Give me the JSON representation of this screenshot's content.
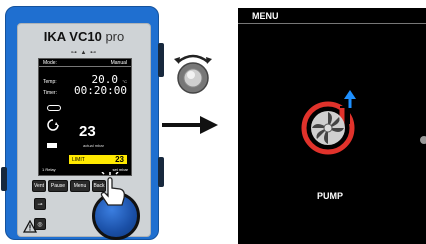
{
  "device": {
    "brand": "IKA VC10",
    "model_suffix": "pro",
    "display": {
      "mode_label": "Mode:",
      "mode_value": "Manual",
      "temp_label": "Temp:",
      "temp_value": "20.0",
      "temp_unit": "°C",
      "timer_label": "Timer:",
      "timer_value": "00:20:00",
      "pressure_value": "23",
      "pressure_caption": "actual mbar",
      "limit_label": "LIMIT",
      "limit_value": "23",
      "footer_left": "1 Relay",
      "footer_right": "set mbar"
    },
    "buttons": [
      "Vent",
      "Pause",
      "Menu",
      "Back"
    ],
    "small_key_1": "⊸",
    "small_key_2": "◎"
  },
  "screen": {
    "title": "MENU",
    "item_label": "PUMP"
  },
  "icons": {
    "knob": "rotate-knob-icon",
    "arrow": "right-arrow-icon",
    "pump": "pump-icon",
    "pointer": "hand-pointer-icon",
    "warning": "warning-icon"
  },
  "colors": {
    "device_blue": "#1f6fd0",
    "limit_yellow": "#ffe900",
    "pump_red": "#e0322b",
    "pump_blue": "#1e90ff"
  }
}
